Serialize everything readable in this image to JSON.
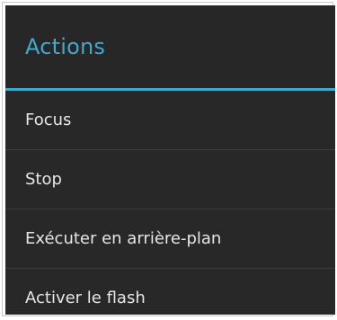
{
  "dialog": {
    "title": "Actions",
    "accent_color": "#3fa9d0",
    "items": [
      {
        "label": "Focus"
      },
      {
        "label": "Stop"
      },
      {
        "label": "Exécuter en arrière-plan"
      },
      {
        "label": "Activer le flash"
      }
    ]
  }
}
